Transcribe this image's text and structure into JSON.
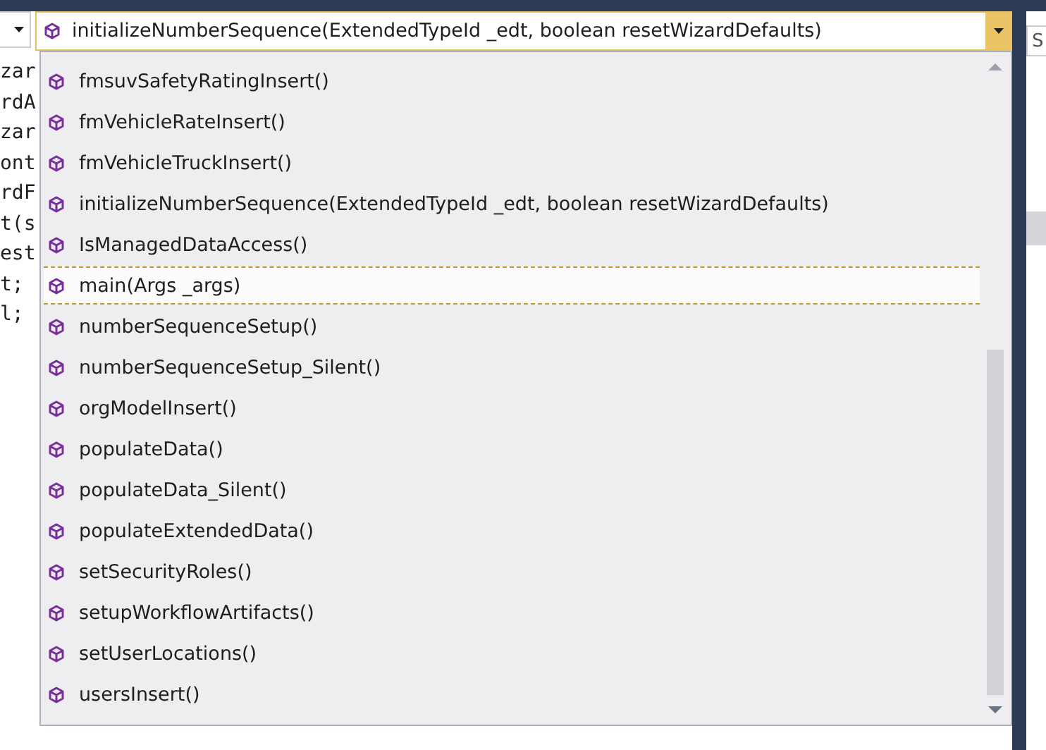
{
  "editor": {
    "code_lines": [
      "zar",
      "rdA",
      "zar",
      "ont",
      "rdF",
      "t(s",
      "est",
      "t;",
      "l;"
    ]
  },
  "member_combo": {
    "value": "initializeNumberSequence(ExtendedTypeId _edt, boolean resetWizardDefaults)"
  },
  "member_list": {
    "items": [
      {
        "label": "fmsuvSafetyRatingInsert()",
        "selected": false
      },
      {
        "label": "fmVehicleRateInsert()",
        "selected": false
      },
      {
        "label": "fmVehicleTruckInsert()",
        "selected": false
      },
      {
        "label": "initializeNumberSequence(ExtendedTypeId _edt, boolean resetWizardDefaults)",
        "selected": false
      },
      {
        "label": "IsManagedDataAccess()",
        "selected": false
      },
      {
        "label": "main(Args _args)",
        "selected": true
      },
      {
        "label": "numberSequenceSetup()",
        "selected": false
      },
      {
        "label": "numberSequenceSetup_Silent()",
        "selected": false
      },
      {
        "label": "orgModelInsert()",
        "selected": false
      },
      {
        "label": "populateData()",
        "selected": false
      },
      {
        "label": "populateData_Silent()",
        "selected": false
      },
      {
        "label": "populateExtendedData()",
        "selected": false
      },
      {
        "label": "setSecurityRoles()",
        "selected": false
      },
      {
        "label": "setupWorkflowArtifacts()",
        "selected": false
      },
      {
        "label": "setUserLocations()",
        "selected": false
      },
      {
        "label": "usersInsert()",
        "selected": false
      }
    ]
  },
  "side_panel": {
    "search_value": "S"
  }
}
